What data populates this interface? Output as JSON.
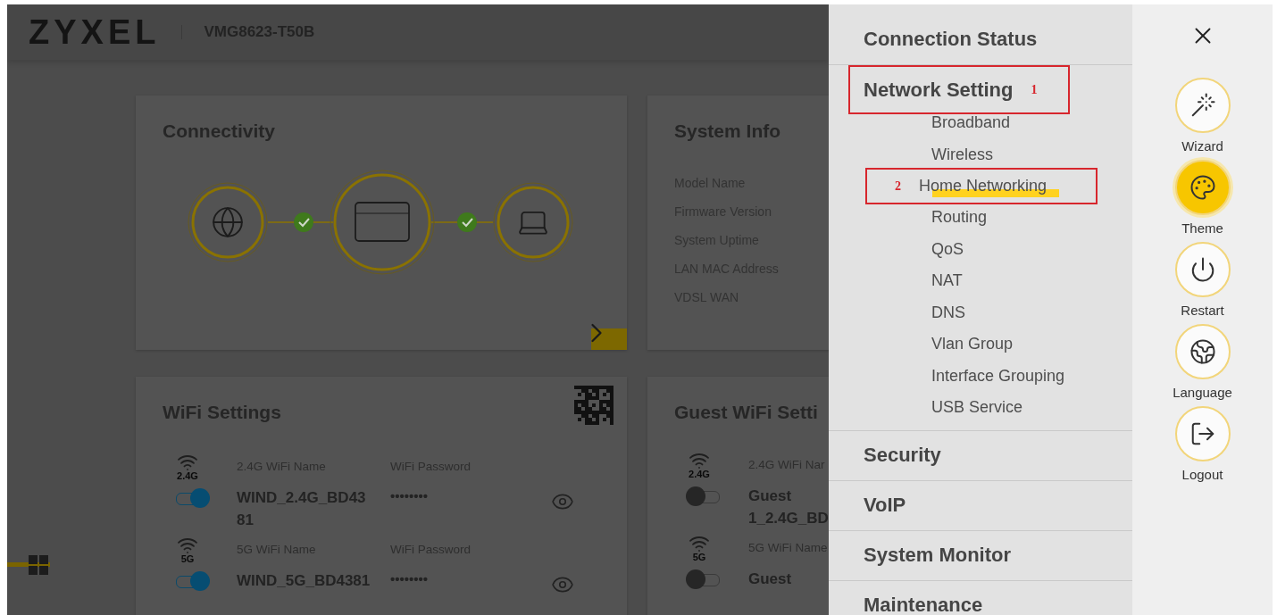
{
  "header": {
    "logo": "ZYXEL",
    "model": "VMG8623-T50B"
  },
  "cards": [
    {
      "kind": "connectivity",
      "title": "Connectivity"
    },
    {
      "kind": "info",
      "title": "System Info",
      "labels": [
        "Model Name",
        "Firmware Version",
        "System Uptime",
        "LAN MAC Address",
        "VDSL WAN"
      ]
    },
    {
      "kind": "wifi",
      "title": "WiFi Settings",
      "bands": [
        {
          "band": "2.4G",
          "name_label": "2.4G WiFi Name",
          "password_label": "WiFi Password",
          "name": "WIND_2.4G_BD4381",
          "password": "••••••••",
          "on": true
        },
        {
          "band": "5G",
          "name_label": "5G WiFi Name",
          "password_label": "WiFi Password",
          "name": "WIND_5G_BD4381",
          "password": "••••••••",
          "on": true
        }
      ]
    },
    {
      "kind": "wifi",
      "title": "Guest WiFi Setti",
      "bands": [
        {
          "band": "2.4G",
          "name_label": "2.4G WiFi Nar",
          "name": "Guest 1_2.4G_BD",
          "on": false
        },
        {
          "band": "5G",
          "name_label": "5G WiFi Name",
          "name": "Guest",
          "on": false
        }
      ]
    }
  ],
  "menu": {
    "sections": [
      {
        "label": "Connection Status",
        "expanded": false
      },
      {
        "label": "Network Setting",
        "expanded": true,
        "marker": "1",
        "items": [
          {
            "label": "Broadband"
          },
          {
            "label": "Wireless"
          },
          {
            "label": "Home Networking",
            "marker": "2",
            "highlighted": true
          },
          {
            "label": "Routing"
          },
          {
            "label": "QoS"
          },
          {
            "label": "NAT"
          },
          {
            "label": "DNS"
          },
          {
            "label": "Vlan Group"
          },
          {
            "label": "Interface Grouping"
          },
          {
            "label": "USB Service"
          }
        ]
      },
      {
        "label": "Security",
        "expanded": false
      },
      {
        "label": "VoIP",
        "expanded": false
      },
      {
        "label": "System Monitor",
        "expanded": false
      },
      {
        "label": "Maintenance",
        "expanded": false
      }
    ]
  },
  "actions": [
    {
      "kind": "wizard",
      "label": "Wizard",
      "selected": false
    },
    {
      "kind": "theme",
      "label": "Theme",
      "selected": true
    },
    {
      "kind": "restart",
      "label": "Restart",
      "selected": false
    },
    {
      "kind": "language",
      "label": "Language",
      "selected": false
    },
    {
      "kind": "logout",
      "label": "Logout",
      "selected": false
    }
  ]
}
